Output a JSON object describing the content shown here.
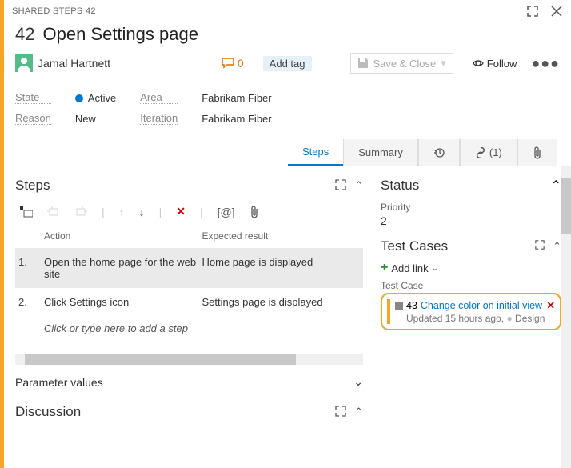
{
  "titlebar": {
    "category": "SHARED STEPS",
    "id": "42"
  },
  "header": {
    "id": "42",
    "title": "Open Settings page",
    "assignee": "Jamal Hartnett",
    "discussion_count": "0",
    "add_tag": "Add tag",
    "save": "Save & Close",
    "follow": "Follow"
  },
  "fields": {
    "state_label": "State",
    "state_value": "Active",
    "area_label": "Area",
    "area_value": "Fabrikam Fiber",
    "reason_label": "Reason",
    "reason_value": "New",
    "iteration_label": "Iteration",
    "iteration_value": "Fabrikam Fiber"
  },
  "tabs": {
    "steps": "Steps",
    "summary": "Summary",
    "links_count": "(1)"
  },
  "steps": {
    "title": "Steps",
    "col_action": "Action",
    "col_expected": "Expected result",
    "rows": [
      {
        "num": "1.",
        "action": "Open the home page for the web site",
        "expected": "Home page is displayed"
      },
      {
        "num": "2.",
        "action": "Click Settings icon",
        "expected": "Settings page is displayed"
      }
    ],
    "placeholder": "Click or type here to add a step",
    "toolbar_at": "[@]"
  },
  "param": {
    "title": "Parameter values"
  },
  "discussion": {
    "title": "Discussion"
  },
  "status": {
    "title": "Status",
    "priority_label": "Priority",
    "priority_value": "2"
  },
  "testcases": {
    "title": "Test Cases",
    "add_link": "Add link",
    "label": "Test Case",
    "card": {
      "id": "43",
      "title": "Change color on initial view",
      "meta_time": "Updated 15 hours ago,",
      "meta_state": "Design"
    }
  }
}
